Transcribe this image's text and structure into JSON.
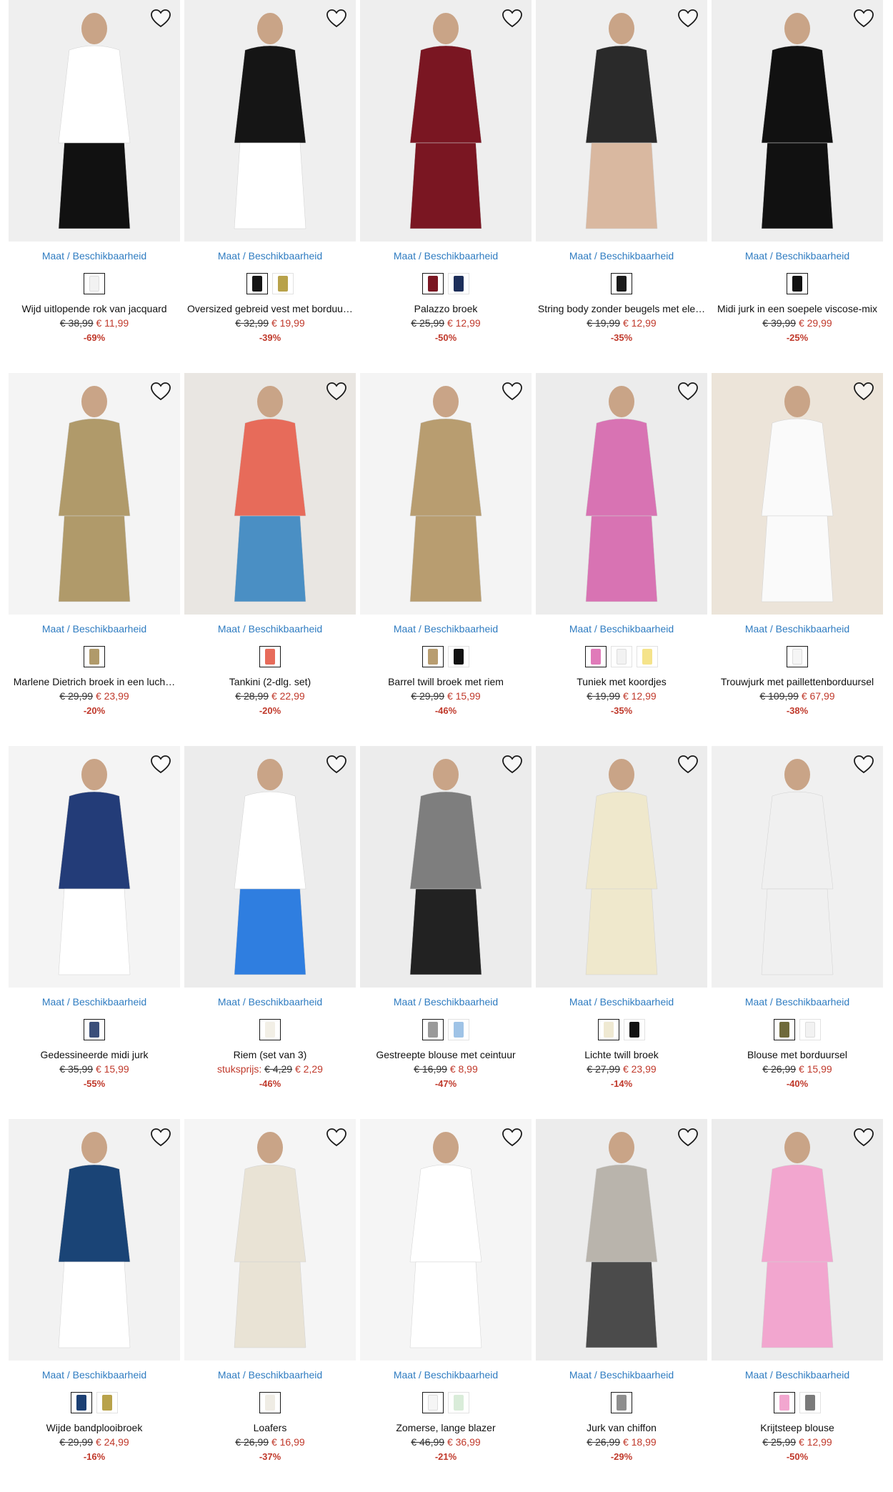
{
  "maat_label": "Maat",
  "beschik_label": "Beschikbaarheid",
  "products": [
    {
      "title": "Wijd uitlopende rok van jacquard",
      "old": "€ 38,99",
      "new": "€ 11,99",
      "discount": "-69%",
      "bg": "#efefef",
      "swatches": [
        "#f2f2f2"
      ],
      "colors": [
        "#ffffff",
        "#111111"
      ]
    },
    {
      "title": "Oversized gebreid vest met borduu…",
      "old": "€ 32,99",
      "new": "€ 19,99",
      "discount": "-39%",
      "bg": "#efefef",
      "swatches": [
        "#151515",
        "#b8a24a"
      ],
      "colors": [
        "#151515",
        "#ffffff"
      ]
    },
    {
      "title": "Palazzo broek",
      "old": "€ 25,99",
      "new": "€ 12,99",
      "discount": "-50%",
      "bg": "#eeeeee",
      "swatches": [
        "#7a1622",
        "#1d2f5a"
      ],
      "colors": [
        "#7a1622",
        "#7a1622"
      ]
    },
    {
      "title": "String body zonder beugels met ele…",
      "old": "€ 19,99",
      "new": "€ 12,99",
      "discount": "-35%",
      "bg": "#efefef",
      "swatches": [
        "#1a1a1a"
      ],
      "colors": [
        "#2a2a2a",
        "#d9b8a0"
      ]
    },
    {
      "title": "Midi jurk in een soepele viscose-mix",
      "old": "€ 39,99",
      "new": "€ 29,99",
      "discount": "-25%",
      "bg": "#eeeeee",
      "swatches": [
        "#111111"
      ],
      "colors": [
        "#111111",
        "#111111"
      ]
    },
    {
      "title": "Marlene Dietrich broek in een luch…",
      "old": "€ 29,99",
      "new": "€ 23,99",
      "discount": "-20%",
      "bg": "#f4f4f4",
      "swatches": [
        "#b09a6a"
      ],
      "colors": [
        "#b09a6a",
        "#b09a6a"
      ]
    },
    {
      "title": "Tankini (2-dlg. set)",
      "old": "€ 28,99",
      "new": "€ 22,99",
      "discount": "-20%",
      "bg": "#e9e6e2",
      "swatches": [
        "#e76b5a"
      ],
      "colors": [
        "#e76b5a",
        "#4a8fc4"
      ]
    },
    {
      "title": "Barrel twill broek met riem",
      "old": "€ 29,99",
      "new": "€ 15,99",
      "discount": "-46%",
      "bg": "#f4f4f4",
      "swatches": [
        "#b89d70",
        "#111111"
      ],
      "colors": [
        "#b89d70",
        "#b89d70"
      ]
    },
    {
      "title": "Tuniek met koordjes",
      "old": "€ 19,99",
      "new": "€ 12,99",
      "discount": "-35%",
      "bg": "#ececec",
      "swatches": [
        "#e07ab9",
        "#f2f2f2",
        "#f5e38a"
      ],
      "colors": [
        "#d873b3",
        "#d873b3"
      ]
    },
    {
      "title": "Trouwjurk met paillettenborduursel",
      "old": "€ 109,99",
      "new": "€ 67,99",
      "discount": "-38%",
      "bg": "#ece4d9",
      "swatches": [
        "#f5f5f5"
      ],
      "colors": [
        "#fafafa",
        "#fafafa"
      ]
    },
    {
      "title": "Gedessineerde midi jurk",
      "old": "€ 35,99",
      "new": "€ 15,99",
      "discount": "-55%",
      "bg": "#f4f4f4",
      "swatches": [
        "#3b4f7a"
      ],
      "colors": [
        "#233c78",
        "#ffffff"
      ]
    },
    {
      "title": "Riem (set van 3)",
      "old": "€ 4,29",
      "new": "€ 2,29",
      "discount": "-46%",
      "unit_label": "stuksprijs:",
      "bg": "#ececec",
      "swatches": [
        "#f2efe6"
      ],
      "colors": [
        "#ffffff",
        "#2f7ee0"
      ]
    },
    {
      "title": "Gestreepte blouse met ceintuur",
      "old": "€ 16,99",
      "new": "€ 8,99",
      "discount": "-47%",
      "bg": "#ececec",
      "swatches": [
        "#9a9a9a",
        "#9fc3e6"
      ],
      "colors": [
        "#7e7e7e",
        "#222222"
      ]
    },
    {
      "title": "Lichte twill broek",
      "old": "€ 27,99",
      "new": "€ 23,99",
      "discount": "-14%",
      "bg": "#ececec",
      "swatches": [
        "#efe9d2",
        "#111111"
      ],
      "colors": [
        "#efe8cc",
        "#efe8cc"
      ]
    },
    {
      "title": "Blouse met borduursel",
      "old": "€ 26,99",
      "new": "€ 15,99",
      "discount": "-40%",
      "bg": "#f0f0f0",
      "swatches": [
        "#6f6a3a",
        "#f2f2f2"
      ],
      "colors": [
        "#f0f0f0",
        "#f0f0f0"
      ]
    },
    {
      "title": "Wijde bandplooibroek",
      "old": "€ 29,99",
      "new": "€ 24,99",
      "discount": "-16%",
      "bg": "#f2f2f2",
      "swatches": [
        "#1b3f73",
        "#b8a24a"
      ],
      "colors": [
        "#1a4476",
        "#ffffff"
      ]
    },
    {
      "title": "Loafers",
      "old": "€ 26,99",
      "new": "€ 16,99",
      "discount": "-37%",
      "bg": "#f5f5f5",
      "swatches": [
        "#efece4"
      ],
      "colors": [
        "#e9e3d5",
        "#e9e3d5"
      ]
    },
    {
      "title": "Zomerse, lange blazer",
      "old": "€ 46,99",
      "new": "€ 36,99",
      "discount": "-21%",
      "bg": "#f5f5f5",
      "swatches": [
        "#f5f5f5",
        "#d9ecd9"
      ],
      "colors": [
        "#ffffff",
        "#ffffff"
      ]
    },
    {
      "title": "Jurk van chiffon",
      "old": "€ 26,99",
      "new": "€ 18,99",
      "discount": "-29%",
      "bg": "#ececec",
      "swatches": [
        "#8e8e8e"
      ],
      "colors": [
        "#b9b4ac",
        "#4b4b4b"
      ]
    },
    {
      "title": "Krijtsteep blouse",
      "old": "€ 25,99",
      "new": "€ 12,99",
      "discount": "-50%",
      "bg": "#ececec",
      "swatches": [
        "#f2a6cf",
        "#7a7a7a"
      ],
      "colors": [
        "#f2a6cf",
        "#f2a6cf"
      ]
    }
  ]
}
